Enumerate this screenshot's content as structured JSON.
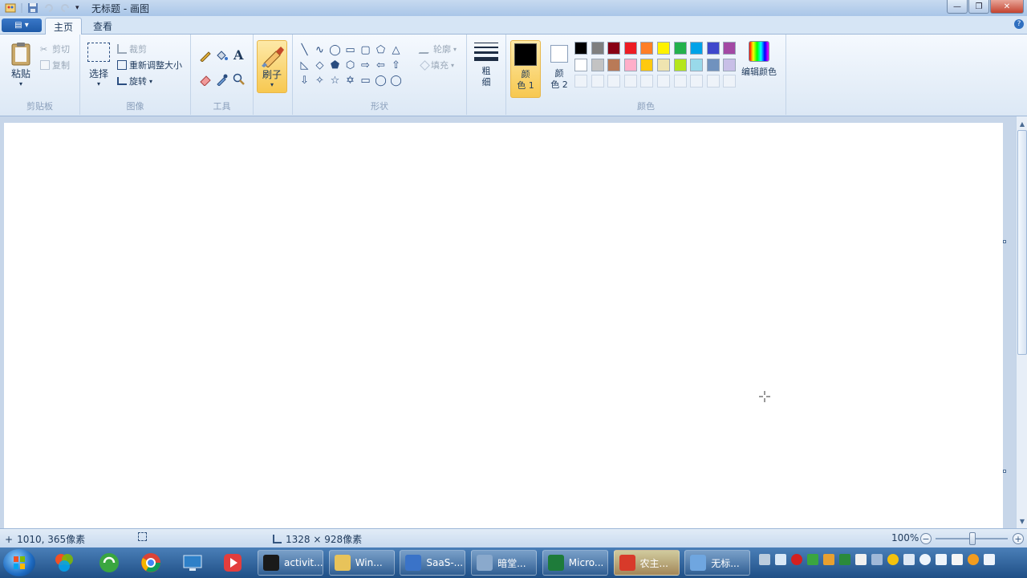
{
  "window": {
    "title": "无标题 - 画图",
    "minimize_label": "—",
    "maximize_label": "❐",
    "close_label": "✕"
  },
  "tabs": {
    "app_menu_label": "▤ ▾",
    "home": "主页",
    "view": "查看",
    "help": "?"
  },
  "clipboard": {
    "paste": "粘贴",
    "cut": "剪切",
    "copy": "复制",
    "group_label": "剪贴板"
  },
  "image": {
    "select": "选择",
    "crop": "裁剪",
    "resize": "重新调整大小",
    "rotate": "旋转",
    "group_label": "图像"
  },
  "tools": {
    "group_label": "工具"
  },
  "brushes": {
    "label": "刷子"
  },
  "shapes": {
    "outline": "轮廓",
    "fill": "填充",
    "group_label": "形状",
    "glyphs": [
      "╲",
      "∿",
      "◯",
      "▭",
      "▢",
      "⬠",
      "△",
      "◺",
      "◇",
      "⬟",
      "⬡",
      "⇨",
      "⇦",
      "⇧",
      "⇩",
      "✧",
      "☆",
      "✡",
      "▭",
      "◯",
      "◯"
    ]
  },
  "size": {
    "label_top": "粗",
    "label_bottom": "细"
  },
  "colors": {
    "color1_top": "颜",
    "color1_bottom": "色 1",
    "color2_top": "颜",
    "color2_bottom": "色 2",
    "color1_value": "#000000",
    "color2_value": "#ffffff",
    "edit_colors": "编辑颜色",
    "group_label": "颜色",
    "palette": [
      "#000000",
      "#7f7f7f",
      "#880015",
      "#ed1c24",
      "#ff7f27",
      "#fff200",
      "#22b14c",
      "#00a2e8",
      "#3f48cc",
      "#a349a4",
      "#ffffff",
      "#c3c3c3",
      "#b97a57",
      "#ffaec9",
      "#ffc90e",
      "#efe4b0",
      "#b5e61d",
      "#99d9ea",
      "#7092be",
      "#c8bfe7"
    ]
  },
  "statusbar": {
    "cursor_pos": "1010, 365像素",
    "canvas_size": "1328 × 928像素",
    "zoom": "100%"
  },
  "taskbar": {
    "tasks": [
      {
        "label": "activit...",
        "color": "#1a1a1a"
      },
      {
        "label": "Win...",
        "color": "#e8c35a"
      },
      {
        "label": "SaaS-...",
        "color": "#3a73c8"
      },
      {
        "label": "暗堂...",
        "color": "#8aa9cc"
      },
      {
        "label": "Micro...",
        "color": "#1e7b3a"
      },
      {
        "label": "农主...",
        "color": "#d83a2a"
      },
      {
        "label": "无标...",
        "color": "#6fa6e0"
      }
    ]
  }
}
